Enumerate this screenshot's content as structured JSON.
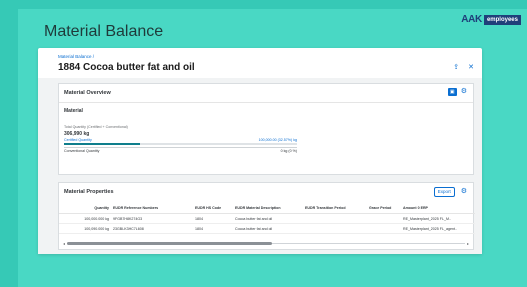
{
  "brand": {
    "logo_text": "AAK",
    "tag": "employees"
  },
  "page": {
    "heading": "Material Balance"
  },
  "object_header": {
    "breadcrumb": "Material Balance /",
    "title": "1884 Cocoa butter fat and oil",
    "icons": [
      "share-icon",
      "close-icon"
    ]
  },
  "overview": {
    "title": "Material Overview",
    "subsection": "Material",
    "total_label": "Total Quantity (Certified + Conventional)",
    "total_value": "306,990 kg",
    "rows": [
      {
        "label": "Certified Quantity",
        "value": "100,000.00 (32.57%) kg"
      },
      {
        "label": "Conventional Quantity",
        "value": "0 kg (0 %)"
      }
    ],
    "certified_share": 0.3257
  },
  "properties": {
    "title": "Material Properties",
    "export_label": "Export",
    "columns": [
      "Quantity",
      "EUDR Reference Numbers",
      "EUDR HS Code",
      "EUDR Material Description",
      "EUDR Transition Period",
      "Grace Period",
      "Amount 0 ERP"
    ],
    "rows": [
      [
        "100,000.000 kg",
        "9FGB7H8K274G3",
        "1804",
        "Cocoa butter fat and oil",
        "",
        "",
        "RE_Masterplant_2025 FL_M.."
      ],
      [
        "100,090.000 kg",
        "23GBLK3HC7L608",
        "1804",
        "Cocoa butter fat and oil",
        "",
        "",
        "RE_Masterplant_2025 FL_agent.."
      ]
    ]
  },
  "colors": {
    "background": "#36c9b6",
    "accent": "#0a6ed1",
    "progress": "#0f7e8c"
  }
}
